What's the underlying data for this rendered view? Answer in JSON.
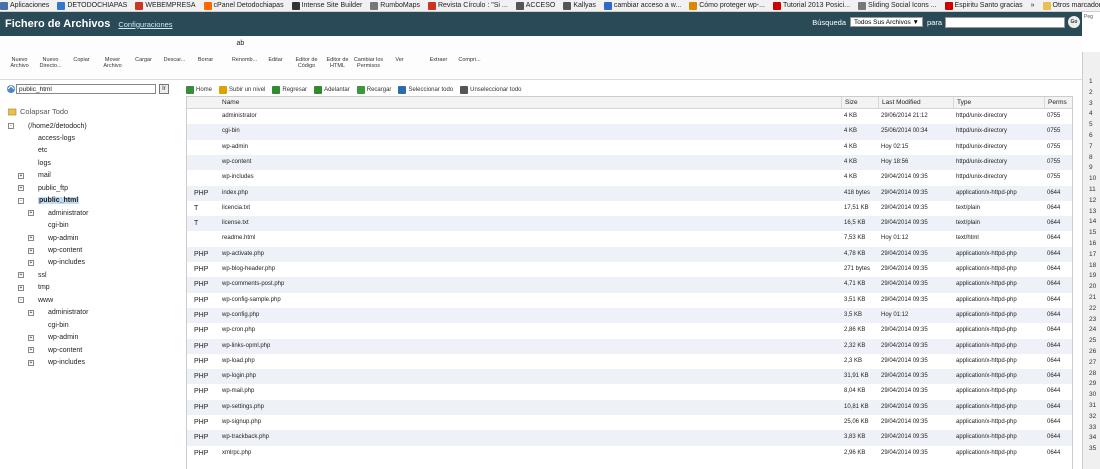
{
  "bookmarks": [
    {
      "label": "Aplicaciones",
      "color": "#4a6fa5"
    },
    {
      "label": "DETODOCHIAPAS",
      "color": "#3377cc"
    },
    {
      "label": "WEBEMPRESA",
      "color": "#cc3322"
    },
    {
      "label": "cPanel Detodochiapas",
      "color": "#ff6600"
    },
    {
      "label": "Intense Site Builder",
      "color": "#333333"
    },
    {
      "label": "RumboMaps",
      "color": "#777777"
    },
    {
      "label": "Revista Círculo : \"Si ...",
      "color": "#cc3322"
    },
    {
      "label": "ACCESO",
      "color": "#555555"
    },
    {
      "label": "Kallyas",
      "color": "#555555"
    },
    {
      "label": "cambiar acceso a w...",
      "color": "#3366cc"
    },
    {
      "label": "Cómo proteger wp-...",
      "color": "#dd8800"
    },
    {
      "label": "Tutorial 2013 Posici...",
      "color": "#cc0000"
    },
    {
      "label": "Sliding Social Icons ...",
      "color": "#777777"
    },
    {
      "label": "Espiritu Santo gracias",
      "color": "#cc0000"
    },
    {
      "label": "»",
      "color": ""
    },
    {
      "label": "Otros marcadores",
      "color": "#e8c050"
    }
  ],
  "header": {
    "title": "Fichero de Archivos",
    "config_link": "Configuraciones",
    "search_label": "Búsqueda",
    "search_scope": "Todos Sus Archivos",
    "search_para": "para",
    "go": "Go"
  },
  "toolbar": [
    {
      "label": "Nuevo Archivo",
      "icon": "new-file-icon"
    },
    {
      "label": "Nuevo Directo...",
      "icon": "new-folder-icon"
    },
    {
      "label": "Copiar",
      "icon": "copy-icon"
    },
    {
      "label": "Mover Archivo",
      "icon": "move-icon"
    },
    {
      "label": "Cargar",
      "icon": "upload-icon"
    },
    {
      "label": "Descar...",
      "icon": "download-icon"
    },
    {
      "label": "Borrar",
      "icon": "delete-icon"
    },
    {
      "label": "Renomb...",
      "icon": "rename-icon"
    },
    {
      "label": "Editar",
      "icon": "edit-icon"
    },
    {
      "label": "Editor de Código",
      "icon": "code-editor-icon"
    },
    {
      "label": "Editor de HTML",
      "icon": "html-editor-icon"
    },
    {
      "label": "Cambiar los Permisos",
      "icon": "permissions-icon"
    },
    {
      "label": "Ver",
      "icon": "view-icon"
    },
    {
      "label": "Extraer",
      "icon": "extract-icon"
    },
    {
      "label": "Compri...",
      "icon": "compress-icon"
    }
  ],
  "left": {
    "path": "public_html",
    "go": "Ir",
    "collapse": "Colapsar Todo",
    "tree": [
      {
        "label": "(/home2/detodoch)",
        "level": 0,
        "exp": "-",
        "kind": "home"
      },
      {
        "label": "access-logs",
        "level": 1,
        "exp": "",
        "kind": "folder"
      },
      {
        "label": "etc",
        "level": 1,
        "exp": "",
        "kind": "folder"
      },
      {
        "label": "logs",
        "level": 1,
        "exp": "",
        "kind": "folder"
      },
      {
        "label": "mail",
        "level": 1,
        "exp": "+",
        "kind": "mail"
      },
      {
        "label": "public_ftp",
        "level": 1,
        "exp": "+",
        "kind": "ftp"
      },
      {
        "label": "public_html",
        "level": 1,
        "exp": "-",
        "kind": "web",
        "selected": true
      },
      {
        "label": "administrator",
        "level": 2,
        "exp": "+",
        "kind": "folder"
      },
      {
        "label": "cgi-bin",
        "level": 2,
        "exp": "",
        "kind": "folder"
      },
      {
        "label": "wp-admin",
        "level": 2,
        "exp": "+",
        "kind": "folder"
      },
      {
        "label": "wp-content",
        "level": 2,
        "exp": "+",
        "kind": "folder"
      },
      {
        "label": "wp-includes",
        "level": 2,
        "exp": "+",
        "kind": "folder"
      },
      {
        "label": "ssl",
        "level": 1,
        "exp": "+",
        "kind": "folder"
      },
      {
        "label": "tmp",
        "level": 1,
        "exp": "+",
        "kind": "folder"
      },
      {
        "label": "www",
        "level": 1,
        "exp": "-",
        "kind": "web"
      },
      {
        "label": "administrator",
        "level": 2,
        "exp": "+",
        "kind": "folder"
      },
      {
        "label": "cgi-bin",
        "level": 2,
        "exp": "",
        "kind": "folder"
      },
      {
        "label": "wp-admin",
        "level": 2,
        "exp": "+",
        "kind": "folder"
      },
      {
        "label": "wp-content",
        "level": 2,
        "exp": "+",
        "kind": "folder"
      },
      {
        "label": "wp-includes",
        "level": 2,
        "exp": "+",
        "kind": "folder"
      }
    ]
  },
  "actions": [
    {
      "label": "Home",
      "color": "#3a8c3a"
    },
    {
      "label": "Subir un nivel",
      "color": "#d9a400"
    },
    {
      "label": "Regresar",
      "color": "#2e8b2e"
    },
    {
      "label": "Adelantar",
      "color": "#2e8b2e"
    },
    {
      "label": "Recargar",
      "color": "#3a9a3a"
    },
    {
      "label": "Seleccionar todo",
      "color": "#2b6cb0"
    },
    {
      "label": "Unseleccionar todo",
      "color": "#555555"
    }
  ],
  "columns": {
    "name": "Name",
    "size": "Size",
    "modified": "Last Modified",
    "type": "Type",
    "perms": "Perms"
  },
  "files": [
    {
      "name": "administrator",
      "size": "4 KB",
      "modified": "29/06/2014 21:12",
      "type": "httpd/unix-directory",
      "perms": "0755",
      "kind": "dir"
    },
    {
      "name": "cgi-bin",
      "size": "4 KB",
      "modified": "25/06/2014 00:34",
      "type": "httpd/unix-directory",
      "perms": "0755",
      "kind": "dir"
    },
    {
      "name": "wp-admin",
      "size": "4 KB",
      "modified": "Hoy 02:15",
      "type": "httpd/unix-directory",
      "perms": "0755",
      "kind": "dir"
    },
    {
      "name": "wp-content",
      "size": "4 KB",
      "modified": "Hoy 18:56",
      "type": "httpd/unix-directory",
      "perms": "0755",
      "kind": "dir"
    },
    {
      "name": "wp-includes",
      "size": "4 KB",
      "modified": "29/04/2014 09:35",
      "type": "httpd/unix-directory",
      "perms": "0755",
      "kind": "dir"
    },
    {
      "name": "index.php",
      "size": "418 bytes",
      "modified": "29/04/2014 09:35",
      "type": "application/x-httpd-php",
      "perms": "0644",
      "kind": "php"
    },
    {
      "name": "licencia.txt",
      "size": "17,51 KB",
      "modified": "29/04/2014 09:35",
      "type": "text/plain",
      "perms": "0644",
      "kind": "txt"
    },
    {
      "name": "license.txt",
      "size": "16,5 KB",
      "modified": "29/04/2014 09:35",
      "type": "text/plain",
      "perms": "0644",
      "kind": "txt"
    },
    {
      "name": "readme.html",
      "size": "7,53 KB",
      "modified": "Hoy 01:12",
      "type": "text/html",
      "perms": "0644",
      "kind": "html"
    },
    {
      "name": "wp-activate.php",
      "size": "4,78 KB",
      "modified": "29/04/2014 09:35",
      "type": "application/x-httpd-php",
      "perms": "0644",
      "kind": "php"
    },
    {
      "name": "wp-blog-header.php",
      "size": "271 bytes",
      "modified": "29/04/2014 09:35",
      "type": "application/x-httpd-php",
      "perms": "0644",
      "kind": "php"
    },
    {
      "name": "wp-comments-post.php",
      "size": "4,71 KB",
      "modified": "29/04/2014 09:35",
      "type": "application/x-httpd-php",
      "perms": "0644",
      "kind": "php"
    },
    {
      "name": "wp-config-sample.php",
      "size": "3,51 KB",
      "modified": "29/04/2014 09:35",
      "type": "application/x-httpd-php",
      "perms": "0644",
      "kind": "php"
    },
    {
      "name": "wp-config.php",
      "size": "3,5 KB",
      "modified": "Hoy 01:12",
      "type": "application/x-httpd-php",
      "perms": "0644",
      "kind": "php"
    },
    {
      "name": "wp-cron.php",
      "size": "2,86 KB",
      "modified": "29/04/2014 09:35",
      "type": "application/x-httpd-php",
      "perms": "0644",
      "kind": "php"
    },
    {
      "name": "wp-links-opml.php",
      "size": "2,32 KB",
      "modified": "29/04/2014 09:35",
      "type": "application/x-httpd-php",
      "perms": "0644",
      "kind": "php"
    },
    {
      "name": "wp-load.php",
      "size": "2,3 KB",
      "modified": "29/04/2014 09:35",
      "type": "application/x-httpd-php",
      "perms": "0644",
      "kind": "php"
    },
    {
      "name": "wp-login.php",
      "size": "31,91 KB",
      "modified": "29/04/2014 09:35",
      "type": "application/x-httpd-php",
      "perms": "0644",
      "kind": "php"
    },
    {
      "name": "wp-mail.php",
      "size": "8,04 KB",
      "modified": "29/04/2014 09:35",
      "type": "application/x-httpd-php",
      "perms": "0644",
      "kind": "php"
    },
    {
      "name": "wp-settings.php",
      "size": "10,81 KB",
      "modified": "29/04/2014 09:35",
      "type": "application/x-httpd-php",
      "perms": "0644",
      "kind": "php"
    },
    {
      "name": "wp-signup.php",
      "size": "25,06 KB",
      "modified": "29/04/2014 09:35",
      "type": "application/x-httpd-php",
      "perms": "0644",
      "kind": "php"
    },
    {
      "name": "wp-trackback.php",
      "size": "3,83 KB",
      "modified": "29/04/2014 09:35",
      "type": "application/x-httpd-php",
      "perms": "0644",
      "kind": "php"
    },
    {
      "name": "xmlrpc.php",
      "size": "2,96 KB",
      "modified": "29/04/2014 09:35",
      "type": "application/x-httpd-php",
      "perms": "0644",
      "kind": "php"
    }
  ],
  "sidebar_numbers": [
    "1",
    "2",
    "3",
    "4",
    "5",
    "6",
    "7",
    "8",
    "9",
    "10",
    "11",
    "12",
    "13",
    "14",
    "15",
    "16",
    "17",
    "18",
    "19",
    "20",
    "21",
    "22",
    "23",
    "24",
    "25",
    "26",
    "27",
    "28",
    "29",
    "30",
    "31",
    "32",
    "33",
    "34",
    "35"
  ],
  "sidebar_peek": "Peg"
}
